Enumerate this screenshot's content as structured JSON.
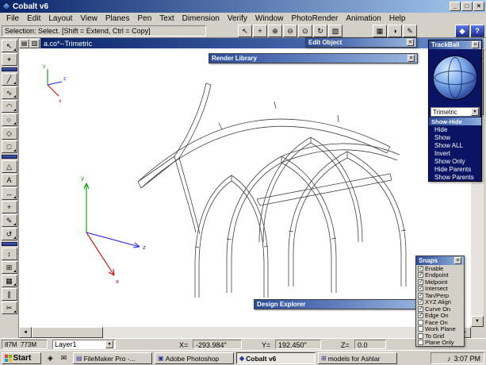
{
  "window": {
    "title": "Cobalt v6",
    "controls": {
      "minimize": "_",
      "maximize": "□",
      "close": "×"
    }
  },
  "menu_bar": {
    "items": [
      "File",
      "Edit",
      "Layout",
      "View",
      "Planes",
      "Pen",
      "Text",
      "Dimension",
      "Verify",
      "Window",
      "PhotoRender",
      "Animation",
      "Help"
    ]
  },
  "toolbar": {
    "message": "Selection: Select. [Shift = Extend, Ctrl = Copy]",
    "icons": [
      "↖",
      "+",
      "⊕",
      "⊖",
      "⊙",
      "↻",
      "▧",
      "▦",
      "◑",
      "✎"
    ],
    "blue_icons": [
      "◆",
      "?"
    ]
  },
  "tool_palette": {
    "tools": [
      "↖",
      "⌖",
      "╱",
      "∿",
      "◠",
      "○",
      "◇",
      "□",
      "△",
      "A",
      "↔",
      "+",
      "✎",
      "↺",
      "↕",
      "⊞",
      "▦",
      "∥",
      "✂"
    ]
  },
  "document": {
    "title": "a.co*--Trimetric"
  },
  "palettes": {
    "edit_object": {
      "title": "Edit Object"
    },
    "render_library": {
      "title": "Render Library"
    },
    "design_explorer": {
      "title": "Design Explorer"
    },
    "trackball": {
      "title": "TrackBall",
      "view": "Trimetric",
      "menu_title": "Show-Hide",
      "items": [
        "Hide",
        "Show",
        "Show ALL",
        "Invert",
        "Show Only",
        "Hide Parents",
        "Show Parents"
      ]
    },
    "snaps": {
      "title": "Snaps",
      "items": [
        {
          "label": "Enable",
          "checked": true
        },
        {
          "label": "Endpoint",
          "checked": true
        },
        {
          "label": "Midpoint",
          "checked": true
        },
        {
          "label": "Intersect",
          "checked": true
        },
        {
          "label": "Tan/Perp",
          "checked": true
        },
        {
          "label": "XYZ Align",
          "checked": true
        },
        {
          "label": "Curve On",
          "checked": true
        },
        {
          "label": "Edge On",
          "checked": true
        },
        {
          "label": "Face On",
          "checked": false
        },
        {
          "label": "Work Plane",
          "checked": false
        },
        {
          "label": "To Grid",
          "checked": false
        },
        {
          "label": "Plane Only",
          "checked": false
        }
      ]
    }
  },
  "status_bar": {
    "memory_used": "87M",
    "memory_free": "773M",
    "layer": "Layer1",
    "x_label": "X=",
    "x_value": "-293.984\"",
    "y_label": "Y=",
    "y_value": "192.450\"",
    "z_label": "Z=",
    "z_value": "0.0"
  },
  "scrollbar": {
    "up": "▲",
    "down": "▼",
    "left": "◄",
    "right": "►"
  },
  "taskbar": {
    "start": "Start",
    "quick_launch": [
      "◈",
      "✉"
    ],
    "buttons": [
      {
        "glyph": "▤",
        "label": "FileMaker Pro -..."
      },
      {
        "glyph": "▣",
        "label": "Adobe Photoshop"
      },
      {
        "glyph": "◆",
        "label": "Cobalt v6"
      },
      {
        "glyph": "⊞",
        "label": "models for Ashlar"
      }
    ],
    "tray_icon": "♪",
    "time": "3:07 PM"
  },
  "colors": {
    "titlebar_left": "#0a246a",
    "titlebar_right": "#a6caf0",
    "trackball_panel": "#0a1464",
    "axis_x": "#e00000",
    "axis_y": "#00a000",
    "axis_z": "#2020ff"
  }
}
